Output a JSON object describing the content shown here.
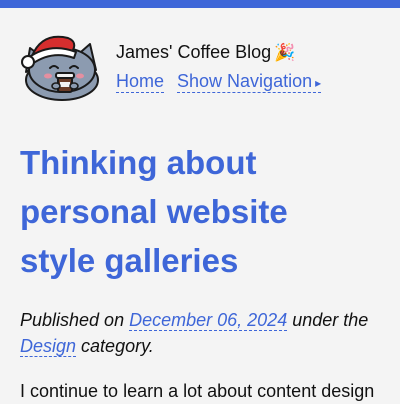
{
  "site": {
    "title": "James' Coffee Blog",
    "title_emoji": "🎉",
    "accent_color": "#3e66d8"
  },
  "nav": {
    "home_label": "Home",
    "show_navigation_label": "Show Navigation",
    "caret_icon": "▸"
  },
  "post": {
    "title_lines": [
      "Thinking about",
      "personal website",
      "style galleries"
    ],
    "meta": {
      "published_prefix": "Published on",
      "date": "December 06, 2024",
      "under_text": "under the",
      "category": "Design",
      "category_suffix": "category."
    },
    "intro": "I continue to learn a lot about content design"
  },
  "logo_icon": "cat-with-santa-hat-drinking-coffee"
}
